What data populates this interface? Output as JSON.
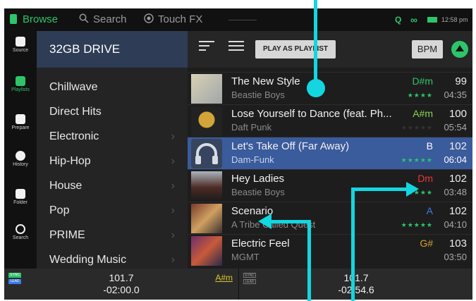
{
  "topbar": {
    "browse": "Browse",
    "search": "Search",
    "touch_fx": "Touch FX",
    "quantize": "Q",
    "link": "∞",
    "clock": "12:58 pm"
  },
  "rail": [
    {
      "label": "Source",
      "icon": "usb-drive-icon"
    },
    {
      "label": "Playlists",
      "icon": "playlist-icon"
    },
    {
      "label": "Prepare",
      "icon": "prepare-icon"
    },
    {
      "label": "History",
      "icon": "clock-icon"
    },
    {
      "label": "Folder",
      "icon": "folder-icon"
    },
    {
      "label": "Search",
      "icon": "search-icon"
    }
  ],
  "folders": {
    "drive": "32GB DRIVE",
    "items": [
      "Chillwave",
      "Direct Hits",
      "Electronic",
      "Hip-Hop",
      "House",
      "Pop",
      "PRIME",
      "Wedding Music"
    ]
  },
  "toolbar": {
    "play_as_playlist": "PLAY AS PLAYLIST",
    "bpm": "BPM"
  },
  "tracks": [
    {
      "title": "The New Style",
      "artist": "Beastie Boys",
      "key": "D#m",
      "key_color": "#2ec46a",
      "stars": "★★★★",
      "bpm": "99",
      "time": "04:35"
    },
    {
      "title": "Lose Yourself to Dance (feat. Ph...",
      "artist": "Daft Punk",
      "key": "A#m",
      "key_color": "#8bd34a",
      "stars": "★★★★★",
      "bpm": "100",
      "time": "05:54"
    },
    {
      "title": "Let's Take Off (Far Away)",
      "artist": "Dam-Funk",
      "key": "B",
      "key_color": "#ffffff",
      "stars": "★★★★★",
      "bpm": "102",
      "time": "06:04"
    },
    {
      "title": "Hey Ladies",
      "artist": "Beastie Boys",
      "key": "Dm",
      "key_color": "#e63a3a",
      "stars": "★★★★",
      "bpm": "102",
      "time": "03:48"
    },
    {
      "title": "Scenario",
      "artist": "A Tribe Called Quest",
      "key": "A",
      "key_color": "#3a7be6",
      "stars": "★★★★★",
      "bpm": "102",
      "time": "04:10"
    },
    {
      "title": "Electric Feel",
      "artist": "MGMT",
      "key": "G#",
      "key_color": "#d6a22f",
      "stars": "",
      "bpm": "103",
      "time": "03:50"
    }
  ],
  "deck1": {
    "sync": "SYNC",
    "lead": "LEAD",
    "bpm": "101.7",
    "time": "-02:00.0",
    "key": "A#m"
  },
  "deck2": {
    "sync": "SYNC",
    "lead": "LEAD",
    "bpm": "101.7",
    "time": "-02:54.6"
  },
  "colors": {
    "accent": "#2ec46a",
    "selected": "#3a5b9c",
    "annotation": "#13d6e0"
  }
}
